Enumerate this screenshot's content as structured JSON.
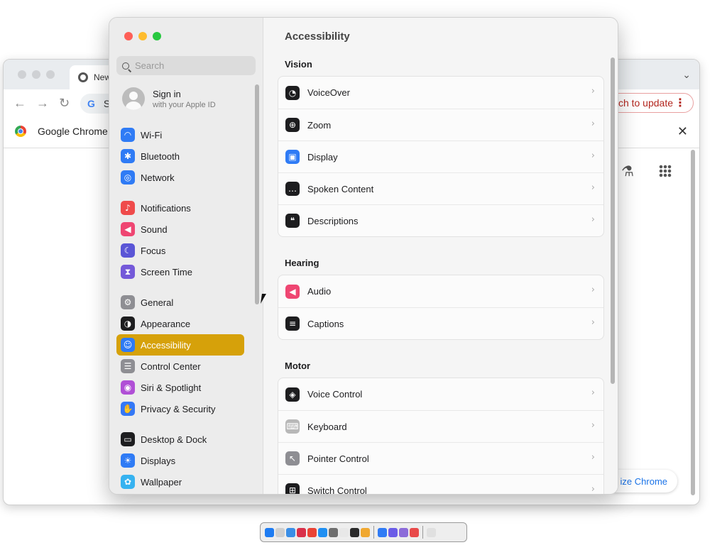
{
  "chrome": {
    "tab_title": "New",
    "omnibox_text": "S",
    "update_button": "ch to update",
    "bookmark": "Google Chrome",
    "customize_button": "ize Chrome"
  },
  "settings": {
    "search_placeholder": "Search",
    "signin": {
      "title": "Sign in",
      "subtitle": "with your Apple ID"
    },
    "sidebar": [
      {
        "label": "Wi-Fi",
        "icon": "wifi-icon",
        "color": "#2f7bf5"
      },
      {
        "label": "Bluetooth",
        "icon": "bluetooth-icon",
        "color": "#2f7bf5"
      },
      {
        "label": "Network",
        "icon": "network-globe-icon",
        "color": "#2f7bf5"
      },
      {
        "label": "Notifications",
        "icon": "bell-icon",
        "color": "#ef4b4b"
      },
      {
        "label": "Sound",
        "icon": "speaker-icon",
        "color": "#ef4672"
      },
      {
        "label": "Focus",
        "icon": "moon-icon",
        "color": "#5a55d6"
      },
      {
        "label": "Screen Time",
        "icon": "hourglass-icon",
        "color": "#7459d9"
      },
      {
        "label": "General",
        "icon": "gear-icon",
        "color": "#8e8e93"
      },
      {
        "label": "Appearance",
        "icon": "appearance-icon",
        "color": "#1d1d1f"
      },
      {
        "label": "Accessibility",
        "icon": "accessibility-icon",
        "color": "#2f7bf5"
      },
      {
        "label": "Control Center",
        "icon": "control-center-icon",
        "color": "#8e8e93"
      },
      {
        "label": "Siri & Spotlight",
        "icon": "siri-icon",
        "color": "#b04fd6"
      },
      {
        "label": "Privacy & Security",
        "icon": "hand-icon",
        "color": "#3478f6"
      },
      {
        "label": "Desktop & Dock",
        "icon": "dock-icon",
        "color": "#1d1d1f"
      },
      {
        "label": "Displays",
        "icon": "sun-icon",
        "color": "#2f7bf5"
      },
      {
        "label": "Wallpaper",
        "icon": "wallpaper-icon",
        "color": "#36b2f0"
      }
    ],
    "content": {
      "title": "Accessibility",
      "sections": [
        {
          "title": "Vision",
          "rows": [
            {
              "label": "VoiceOver",
              "icon": "voiceover-icon",
              "color": "#1d1d1f"
            },
            {
              "label": "Zoom",
              "icon": "zoom-icon",
              "color": "#1d1d1f"
            },
            {
              "label": "Display",
              "icon": "display-icon",
              "color": "#2f7bf5"
            },
            {
              "label": "Spoken Content",
              "icon": "spoken-content-icon",
              "color": "#1d1d1f"
            },
            {
              "label": "Descriptions",
              "icon": "descriptions-icon",
              "color": "#1d1d1f"
            }
          ]
        },
        {
          "title": "Hearing",
          "rows": [
            {
              "label": "Audio",
              "icon": "audio-icon",
              "color": "#ef4672"
            },
            {
              "label": "Captions",
              "icon": "captions-icon",
              "color": "#1d1d1f"
            }
          ]
        },
        {
          "title": "Motor",
          "rows": [
            {
              "label": "Voice Control",
              "icon": "voice-control-icon",
              "color": "#1d1d1f"
            },
            {
              "label": "Keyboard",
              "icon": "keyboard-icon",
              "color": "#b8b8b8"
            },
            {
              "label": "Pointer Control",
              "icon": "pointer-icon",
              "color": "#8e8e93"
            },
            {
              "label": "Switch Control",
              "icon": "switch-control-icon",
              "color": "#1d1d1f"
            }
          ]
        }
      ]
    }
  },
  "dock_apps": [
    "#1e7cf2",
    "#cfcfcf",
    "#3a8ee6",
    "#d9304a",
    "#ea4335",
    "#1f8ff2",
    "#6f6f6f",
    "#e8e8e8",
    "#2b2b2b",
    "#f0a830",
    "#2f7bf5",
    "#6b5ce7",
    "#8c6bd9",
    "#e84a4a",
    "#e0e0e0"
  ]
}
